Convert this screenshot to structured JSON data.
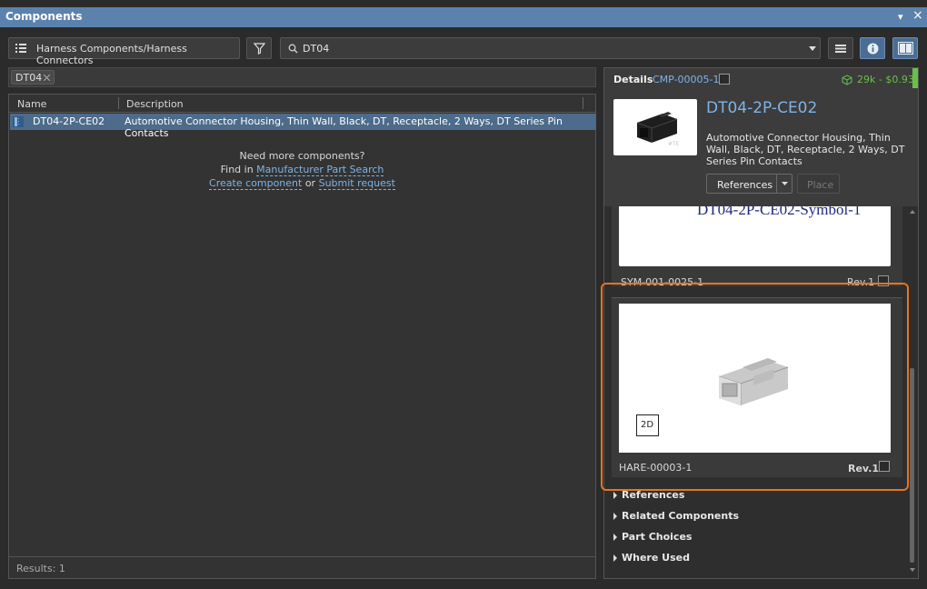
{
  "window": {
    "title": "Components",
    "pin_glyph": "▾",
    "close_glyph": "×"
  },
  "toolbar": {
    "library_path": "Harness Components/Harness Connectors",
    "search_value": "DT04",
    "library_icon": "list-icon",
    "filter_icon": "funnel-icon",
    "search_icon": "magnifier-icon",
    "menu_icon": "hamburger-icon",
    "info_icon": "info-icon",
    "layout_icon": "split-layout-icon"
  },
  "filter_chips": [
    {
      "label": "DT04"
    }
  ],
  "grid": {
    "columns": [
      "Name",
      "Description"
    ],
    "rows": [
      {
        "name": "DT04-2P-CE02",
        "description": "Automotive Connector Housing, Thin Wall, Black, DT, Receptacle, 2 Ways, DT Series Pin Contacts"
      }
    ]
  },
  "more_components": {
    "line1": "Need more components?",
    "find_in": "Find in",
    "manufacturer_search": "Manufacturer Part Search",
    "create_component": "Create component",
    "or": "or",
    "submit_request": "Submit request"
  },
  "status": {
    "results": "Results: 1"
  },
  "details": {
    "header_label": "Details",
    "component_id": "CMP-00005-1",
    "stock_price": "29k - $0.93",
    "stock_icon": "cube-icon",
    "part_name": "DT04-2P-CE02",
    "description": "Automotive Connector Housing, Thin Wall, Black, DT, Receptacle, 2 Ways, DT Series Pin Contacts",
    "references_button": "References",
    "place_button": "Place",
    "thumbnail_logo": "#TE",
    "symbol_card": {
      "symbol_text": "DT04-2P-CE02-Symbol-1",
      "id": "SYM-001-0025-1",
      "rev": "Rev.1"
    },
    "model_card": {
      "view_badge": "2D",
      "id": "HARE-00003-1",
      "rev": "Rev.1"
    },
    "sections": [
      "References",
      "Related Components",
      "Part Choices",
      "Where Used"
    ]
  },
  "colors": {
    "titlebar": "#5b82ad",
    "accent_link": "#7fb3e6",
    "highlight_frame": "#e8741e",
    "selected_row": "#4d6b8a",
    "stock_green": "#6abf4b"
  }
}
